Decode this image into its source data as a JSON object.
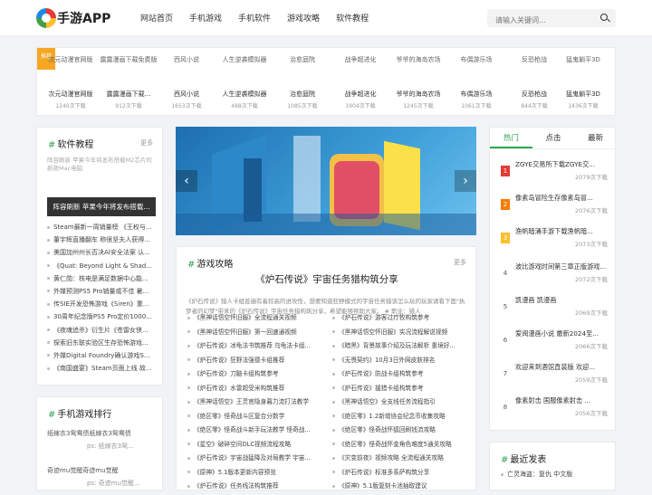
{
  "brand": "手游APP",
  "nav": [
    "网站首页",
    "手机游戏",
    "手机软件",
    "游戏攻略",
    "软件教程"
  ],
  "search": {
    "placeholder": "请输入关键词..."
  },
  "ribbon": "推荐",
  "apps": [
    {
      "pic": "次元动漫官网版",
      "name": "次元动漫官网版",
      "dl": "1240次下载"
    },
    {
      "pic": "露露漫画下载免费版",
      "name": "露露漫画下载...",
      "dl": "912次下载"
    },
    {
      "pic": "西风小说",
      "name": "西风小说",
      "dl": "1653次下载"
    },
    {
      "pic": "人生逆袭模拟器",
      "name": "人生逆袭模拟器",
      "dl": "488次下载"
    },
    {
      "pic": "治愈庭院",
      "name": "治愈庭院",
      "dl": "1085次下载"
    },
    {
      "pic": "战争超进化",
      "name": "战争超进化",
      "dl": "1904次下载"
    },
    {
      "pic": "爷爷的海岛农场",
      "name": "爷爷的海岛农场",
      "dl": "1245次下载"
    },
    {
      "pic": "布偶游乐场",
      "name": "布偶游乐场",
      "dl": "1061次下载"
    },
    {
      "pic": "反恐枪战",
      "name": "反恐枪战",
      "dl": "844次下载"
    },
    {
      "pic": "猛鬼躺平3D",
      "name": "猛鬼躺平3D",
      "dl": "1436次下载"
    }
  ],
  "tutorials": {
    "heading": "软件教程",
    "more": "更多",
    "image_alt": "阵容刷新 苹果今年将发布搭载M2芯片的新款Mac电脑",
    "featured": "阵容刷新 苹果今年将发布搭载...",
    "items": [
      "Steam最新一周销量榜 《王权与...",
      "董宇辉直播翻车 称很坚夫人获得...",
      "美国加州州长否决AI安全法案 认...",
      "《Quat: Beyond Light & Shad...",
      "黄仁勋：核电是满足数据中心能...",
      "外媒预测PS5 Pro销量或不佳 暑...",
      "传SIE开发恐怖游戏《Siren》重...",
      "30周年纪念版PS5 Pro定价1000...",
      "《夜魂追杀》衍生片《苍雷女侠...",
      "探索旧东联实验区生存恐怖游戏...",
      "外媒Digital Foundry确认游戏S...",
      "《南国盛宴》Steam页面上线 故..."
    ]
  },
  "ranking": {
    "heading": "手机游戏排行",
    "items": [
      {
        "name": "纸嫁衣3鸳鸯债纸嫁衣3鸳鸯债",
        "ps": "ps: 纸嫁衣3鸳..."
      },
      {
        "name": "奇迹mu觉醒奇迹mu觉醒",
        "ps": "ps: 奇迹mu觉醒..."
      }
    ]
  },
  "guides": {
    "heading": "游戏攻略",
    "more": "更多",
    "title": "《炉石传说》宇宙任务猎构筑分享",
    "desc": "《炉石传说》猎人卡组普遍有着较高的进攻性，想要知道狂野模式的宇宙任务猎该怎么玩的玩家请看下面\"执梦者的幻梦\"带来的《炉石传说》宇宙任务猎构筑分享，希望能够帮助大家。 # 职业：猎人",
    "left": [
      "《黑神话悟空怀旧服》全流程通关视频",
      "《黑神话悟空怀旧服》第一回速通视频",
      "《炉石传说》冰龟法书筑推荐 乌龟法卡组...",
      "《炉石传说》狂野法强德卡组推荐",
      "《炉石传说》刀脑卡组构筑参考",
      "《炉石传说》水雷超受米构筑推荐",
      "《黑神话悟空》王灵官隐身暮力流打法教学",
      "《绝区零》怪奇战斗区复合分数学",
      "《绝区零》怪奇战斗新手玩法教学 怪奇战...",
      "《星空》破碎空间DLC视频流程攻略",
      "《炉石传说》宇宙战猛降及对局教学 宇宙...",
      "《原神》5.1版本更新内容预览",
      "《炉石传说》任务线法构筑推荐"
    ],
    "right": [
      "《炉石传说》游客过疗牧构筑参考",
      "《黑神话悟空怀旧服》实况流程解说视频",
      "《暗黑》背景故事介绍及玩法解析 重境好...",
      "《无畏契约》10月3日外网皮肤排名",
      "《炉石传说》防战卡组构筑参考",
      "《炉石传说》援猎卡组构筑参考",
      "《黑神话悟空》全支线任务流程指引",
      "《绝区零》1.2新增协会纪念币收集攻略",
      "《绝区零》怪奇战怀狐回刷钱流攻略",
      "《绝区零》怪奇战怀金角色难度5通关攻略",
      "《灾变前夜》视频攻略 全流程通关攻略",
      "《炉石传说》标准多系萨构筑分享",
      "《原神》5.1版复刻卡池抽取建议"
    ]
  },
  "hot": {
    "tabs": [
      "热门",
      "点击",
      "最新"
    ],
    "items": [
      {
        "rank": "1",
        "title": "ZGYE交易所下载ZGYE交...",
        "count": "2079次下载"
      },
      {
        "rank": "2",
        "title": "像素岛冒险生存像素岛冒...",
        "count": "2076次下载"
      },
      {
        "rank": "3",
        "title": "渔帆暗涌手游下载渔帆暗...",
        "count": "2073次下载"
      },
      {
        "rank": "4",
        "title": "波比游戏时间第三章正版游戏...",
        "count": "2072次下载"
      },
      {
        "rank": "5",
        "title": "凯漫画 凯漫画",
        "count": "2069次下载"
      },
      {
        "rank": "6",
        "title": "爱阅漫画小说 最新2024至...",
        "count": "2066次下载"
      },
      {
        "rank": "7",
        "title": "欢迎来到酒馆直装版 欢迎...",
        "count": "2059次下载"
      },
      {
        "rank": "8",
        "title": "像素射击 国服像素射击 ...",
        "count": "2056次下载"
      }
    ]
  },
  "latest": {
    "heading": "最近发表",
    "items": [
      "亡灵海盗：复仇 中文版"
    ]
  },
  "colors": {
    "accent": "#2ea44f",
    "ribbon": "#f5a623"
  }
}
